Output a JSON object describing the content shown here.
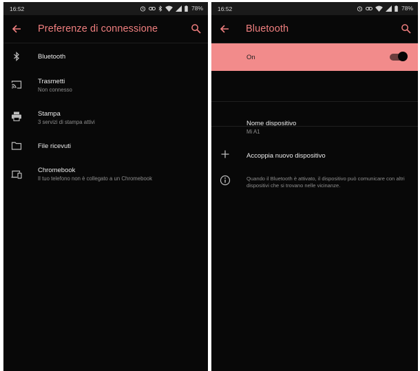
{
  "left": {
    "status": {
      "time": "16:52",
      "battery": "78%"
    },
    "toolbar": {
      "title": "Preferenze di connessione"
    },
    "items": [
      {
        "label": "Bluetooth",
        "sub": ""
      },
      {
        "label": "Trasmetti",
        "sub": "Non connesso"
      },
      {
        "label": "Stampa",
        "sub": "3 servizi di stampa attivi"
      },
      {
        "label": "File ricevuti",
        "sub": ""
      },
      {
        "label": "Chromebook",
        "sub": "Il tuo telefono non è collegato a un Chromebook"
      }
    ]
  },
  "right": {
    "status": {
      "time": "16:52",
      "battery": "78%"
    },
    "toolbar": {
      "title": "Bluetooth"
    },
    "master_switch": {
      "label": "On",
      "state": true
    },
    "device_name": {
      "label": "Nome dispositivo",
      "value": "Mi A1"
    },
    "pair": {
      "label": "Accoppia nuovo dispositivo"
    },
    "info": {
      "text": "Quando il Bluetooth è attivato, il dispositivo può comunicare con altri dispositivi che si trovano nelle vicinanze."
    }
  },
  "colors": {
    "accent": "#f07f7f",
    "highlight": "#f28b8b",
    "background": "#080808"
  },
  "icons": [
    "back-arrow-icon",
    "search-icon",
    "bluetooth-icon",
    "cast-icon",
    "print-icon",
    "folder-icon",
    "chromebook-icon",
    "add-icon",
    "info-icon"
  ]
}
